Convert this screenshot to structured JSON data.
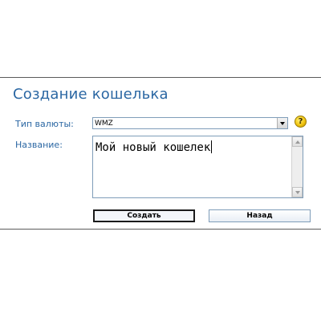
{
  "form": {
    "title": "Создание кошелька",
    "currency_label": "Тип валюты:",
    "currency_value": "WMZ",
    "name_label": "Название:",
    "name_value": "Мой новый кошелек",
    "help_icon": "question-help-icon",
    "help_glyph": "?",
    "create_button": "Создать",
    "back_button": "Назад"
  },
  "colors": {
    "label_blue": "#2b67a3",
    "border_blue": "#7f9db9",
    "help_yellow": "#f1c40f"
  }
}
